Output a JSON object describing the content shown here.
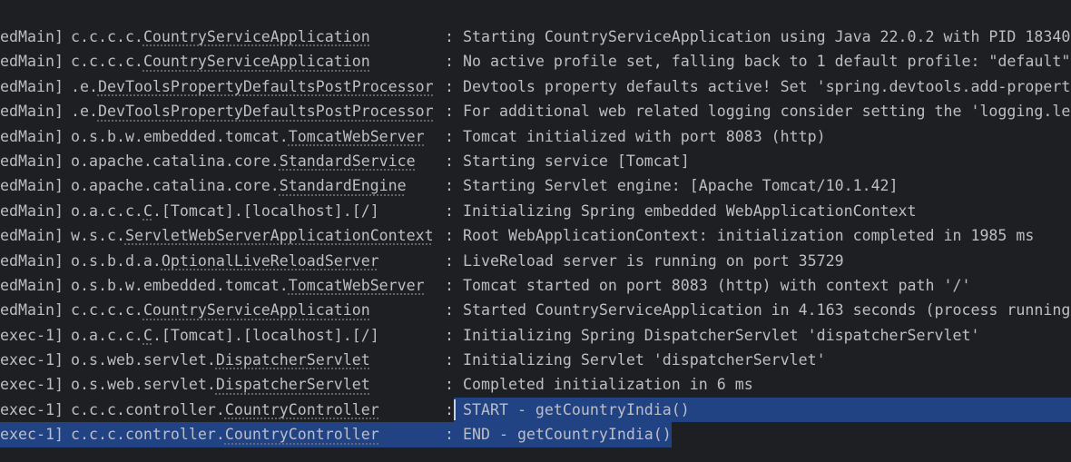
{
  "console": {
    "lines": [
      {
        "thread": "edMain]",
        "pkg": "c.c.c.c.",
        "cls": "CountryServiceApplication",
        "sep": ":",
        "msg": "Starting CountryServiceApplication using Java 22.0.2 with PID 18340"
      },
      {
        "thread": "edMain]",
        "pkg": "c.c.c.c.",
        "cls": "CountryServiceApplication",
        "sep": ":",
        "msg": "No active profile set, falling back to 1 default profile: \"default\""
      },
      {
        "thread": "edMain]",
        "pkg": ".e.",
        "cls": "DevToolsPropertyDefaultsPostProcessor",
        "sep": ":",
        "msg": "Devtools property defaults active! Set 'spring.devtools.add-propert"
      },
      {
        "thread": "edMain]",
        "pkg": ".e.",
        "cls": "DevToolsPropertyDefaultsPostProcessor",
        "sep": ":",
        "msg": "For additional web related logging consider setting the 'logging.le"
      },
      {
        "thread": "edMain]",
        "pkg": "o.s.b.w.embedded.tomcat.",
        "cls": "TomcatWebServer",
        "sep": ":",
        "msg": "Tomcat initialized with port 8083 (http)"
      },
      {
        "thread": "edMain]",
        "pkg": "o.apache.catalina.core.",
        "cls": "StandardService",
        "sep": ":",
        "msg": "Starting service [Tomcat]"
      },
      {
        "thread": "edMain]",
        "pkg": "o.apache.catalina.core.",
        "cls": "StandardEngine",
        "sep": ":",
        "msg": "Starting Servlet engine: [Apache Tomcat/10.1.42]"
      },
      {
        "thread": "edMain]",
        "pkg": "o.a.c.c.",
        "cls": "C",
        "suffix": ".[Tomcat].[localhost].[/]",
        "sep": ":",
        "msg": "Initializing Spring embedded WebApplicationContext"
      },
      {
        "thread": "edMain]",
        "pkg": "w.s.c.",
        "cls": "ServletWebServerApplicationContext",
        "sep": ":",
        "msg": "Root WebApplicationContext: initialization completed in 1985 ms"
      },
      {
        "thread": "edMain]",
        "pkg": "o.s.b.d.a.",
        "cls": "OptionalLiveReloadServer",
        "sep": ":",
        "msg": "LiveReload server is running on port 35729"
      },
      {
        "thread": "edMain]",
        "pkg": "o.s.b.w.embedded.tomcat.",
        "cls": "TomcatWebServer",
        "sep": ":",
        "msg": "Tomcat started on port 8083 (http) with context path '/'"
      },
      {
        "thread": "edMain]",
        "pkg": "c.c.c.c.",
        "cls": "CountryServiceApplication",
        "sep": ":",
        "msg": "Started CountryServiceApplication in 4.163 seconds (process running"
      },
      {
        "thread": "exec-1]",
        "pkg": "o.a.c.c.",
        "cls": "C",
        "suffix": ".[Tomcat].[localhost].[/]",
        "sep": ":",
        "msg": "Initializing Spring DispatcherServlet 'dispatcherServlet'"
      },
      {
        "thread": "exec-1]",
        "pkg": "o.s.web.servlet.",
        "cls": "DispatcherServlet",
        "sep": ":",
        "msg": "Initializing Servlet 'dispatcherServlet'"
      },
      {
        "thread": "exec-1]",
        "pkg": "o.s.web.servlet.",
        "cls": "DispatcherServlet",
        "sep": ":",
        "msg": "Completed initialization in 6 ms"
      },
      {
        "thread": "exec-1]",
        "pkg": "c.c.c.controller.",
        "cls": "CountryController",
        "sep": ":",
        "msg": "START - getCountryIndia()",
        "selection": "msg"
      },
      {
        "thread": "exec-1]",
        "pkg": "c.c.c.controller.",
        "cls": "CountryController",
        "sep": ":",
        "msg": "END - getCountryIndia()",
        "selection": "full"
      }
    ]
  },
  "colors": {
    "background": "#1e1f22",
    "text": "#bcbec4",
    "selection": "#214283",
    "caret": "#ced0d6"
  }
}
